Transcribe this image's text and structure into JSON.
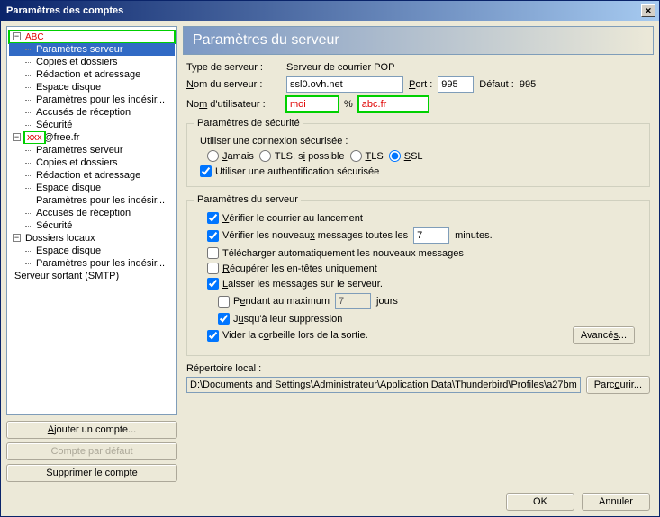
{
  "title": "Paramètres des comptes",
  "tree": {
    "acc1_name": "ABC",
    "acc2_name": "xxx",
    "acc2_domain": "@free.fr",
    "srv_params": "Paramètres serveur",
    "copies": "Copies et dossiers",
    "redaction": "Rédaction et adressage",
    "espace": "Espace disque",
    "junk": "Paramètres pour les indésir...",
    "accuses": "Accusés de réception",
    "securite": "Sécurité",
    "local": "Dossiers locaux",
    "smtp": "Serveur sortant (SMTP)"
  },
  "sidebar_btns": {
    "add": "Ajouter un compte...",
    "default": "Compte par défaut",
    "delete": "Supprimer le compte"
  },
  "header": "Paramètres du serveur",
  "form": {
    "type_lbl": "Type de serveur :",
    "type_val": "Serveur de courrier POP",
    "name_lbl": "Nom du serveur :",
    "name_val": "ssl0.ovh.net",
    "port_lbl": "Port :",
    "port_val": "995",
    "default_lbl": "Défaut :",
    "default_val": "995",
    "user_lbl": "Nom d'utilisateur :",
    "user_val": "moi",
    "user_sep": "%",
    "user_domain": "abc.fr"
  },
  "sec": {
    "legend": "Paramètres de sécurité",
    "use_secure": "Utiliser une connexion sécurisée :",
    "never": "Jamais",
    "tls_if": "TLS, si possible",
    "tls": "TLS",
    "ssl": "SSL",
    "auth": "Utiliser une authentification sécurisée"
  },
  "srv": {
    "legend": "Paramètres du serveur",
    "check_launch": "Vérifier le courrier au lancement",
    "check_new_a": "Vérifier les nouveaux messages toutes les",
    "check_new_val": "7",
    "check_new_b": "minutes.",
    "download": "Télécharger automatiquement les nouveaux messages",
    "headers": "Récupérer les en-têtes uniquement",
    "leave": "Laisser les messages sur le serveur.",
    "pending_a": "Pendant au maximum",
    "pending_val": "7",
    "pending_b": "jours",
    "until_del": "Jusqu'à leur suppression",
    "empty_trash": "Vider la corbeille lors de la sortie.",
    "advanced": "Avancés..."
  },
  "local": {
    "lbl": "Répertoire local :",
    "path": "D:\\Documents and Settings\\Administrateur\\Application Data\\Thunderbird\\Profiles\\a27bm...",
    "browse": "Parcourir..."
  },
  "footer": {
    "ok": "OK",
    "cancel": "Annuler"
  }
}
